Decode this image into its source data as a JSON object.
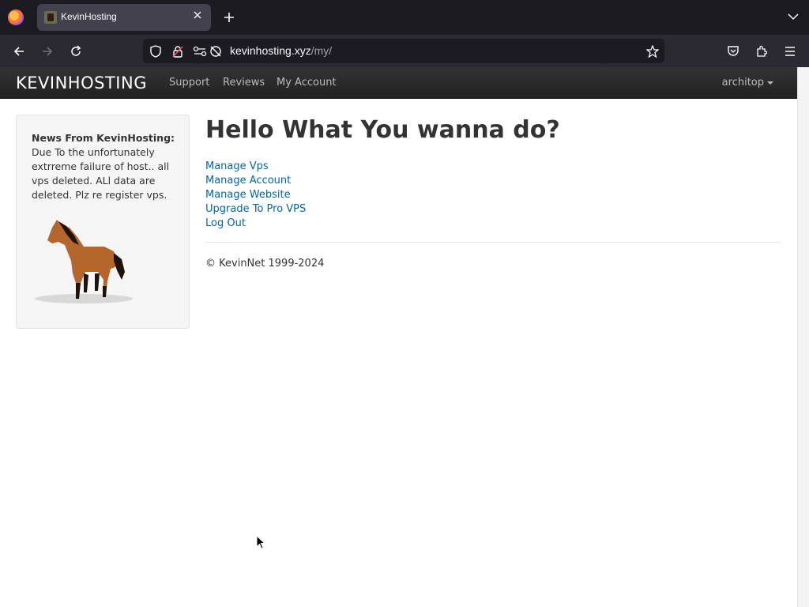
{
  "browser": {
    "tab_title": "KevinHosting",
    "url_domain": "kevinhosting.xyz",
    "url_path": "/my/"
  },
  "site": {
    "brand": "KEVINHOSTING",
    "nav": [
      "Support",
      "Reviews",
      "My Account"
    ],
    "user": "architop"
  },
  "sidebar": {
    "news_heading": "News From KevinHosting:",
    "news_body": "Due To the unfortunately extrreme failure of host.. all vps deleted. ALl data are deleted. Plz re register vps."
  },
  "main": {
    "heading": "Hello What You wanna do?",
    "links": [
      "Manage Vps",
      "Manage Account",
      "Manage Website",
      "Upgrade To Pro VPS",
      "Log Out"
    ],
    "footer": "© KevinNet 1999-2024"
  }
}
